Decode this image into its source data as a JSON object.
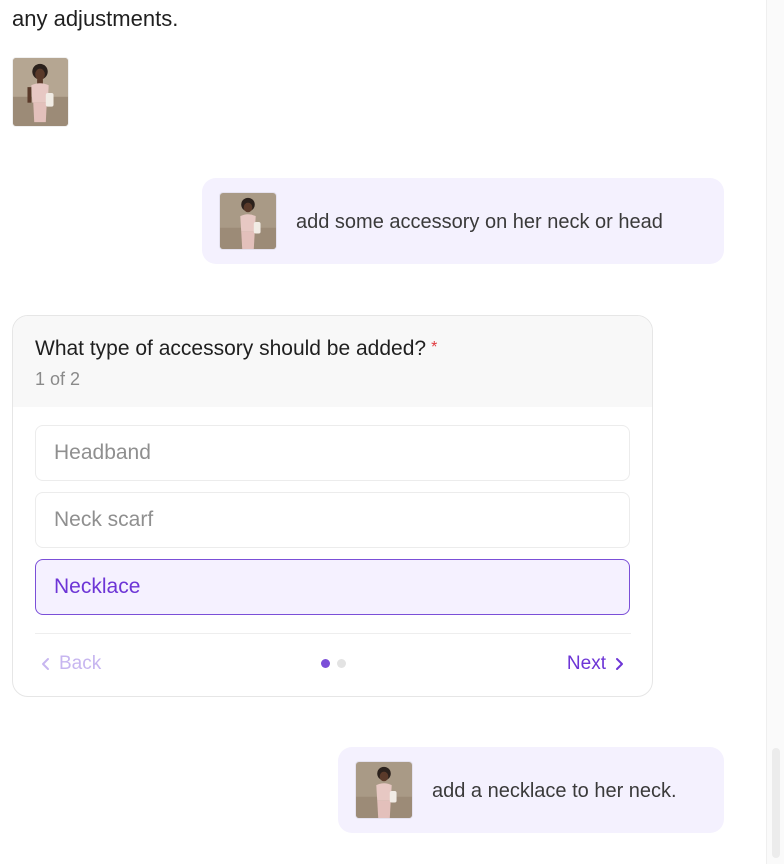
{
  "assistant_message": {
    "text_tail": "any adjustments.",
    "image": "woman-portrait-thumbnail"
  },
  "messages": [
    {
      "text": "add some accessory on her neck or head",
      "image": "woman-portrait-thumbnail"
    },
    {
      "text": "add a necklace to her neck.",
      "image": "woman-portrait-thumbnail"
    }
  ],
  "question_card": {
    "title": "What type of accessory should be added?",
    "required_marker": "*",
    "progress": "1 of 2",
    "options": [
      {
        "label": "Headband",
        "selected": false
      },
      {
        "label": "Neck scarf",
        "selected": false
      },
      {
        "label": "Necklace",
        "selected": true
      }
    ],
    "back_label": "Back",
    "next_label": "Next",
    "current_step": 1,
    "total_steps": 2
  },
  "colors": {
    "accent": "#6d35d6",
    "bubble_bg": "#f4f1fe",
    "selected_bg": "#f5f1ff",
    "required": "#e0393e"
  }
}
